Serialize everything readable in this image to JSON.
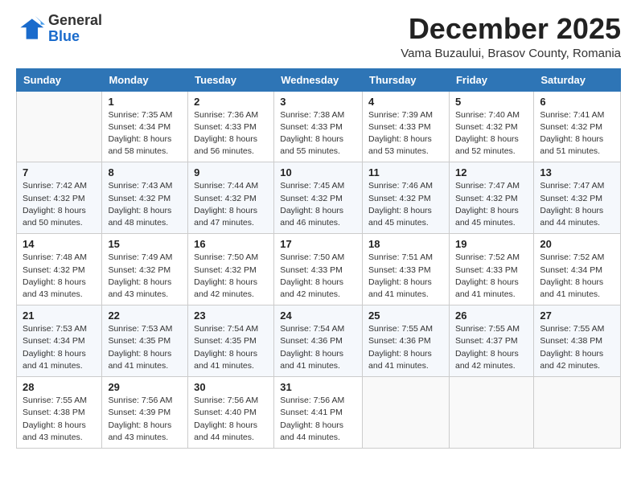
{
  "header": {
    "logo_general": "General",
    "logo_blue": "Blue",
    "month_title": "December 2025",
    "location": "Vama Buzaului, Brasov County, Romania"
  },
  "days_of_week": [
    "Sunday",
    "Monday",
    "Tuesday",
    "Wednesday",
    "Thursday",
    "Friday",
    "Saturday"
  ],
  "weeks": [
    [
      {
        "day": "",
        "info": ""
      },
      {
        "day": "1",
        "info": "Sunrise: 7:35 AM\nSunset: 4:34 PM\nDaylight: 8 hours\nand 58 minutes."
      },
      {
        "day": "2",
        "info": "Sunrise: 7:36 AM\nSunset: 4:33 PM\nDaylight: 8 hours\nand 56 minutes."
      },
      {
        "day": "3",
        "info": "Sunrise: 7:38 AM\nSunset: 4:33 PM\nDaylight: 8 hours\nand 55 minutes."
      },
      {
        "day": "4",
        "info": "Sunrise: 7:39 AM\nSunset: 4:33 PM\nDaylight: 8 hours\nand 53 minutes."
      },
      {
        "day": "5",
        "info": "Sunrise: 7:40 AM\nSunset: 4:32 PM\nDaylight: 8 hours\nand 52 minutes."
      },
      {
        "day": "6",
        "info": "Sunrise: 7:41 AM\nSunset: 4:32 PM\nDaylight: 8 hours\nand 51 minutes."
      }
    ],
    [
      {
        "day": "7",
        "info": "Sunrise: 7:42 AM\nSunset: 4:32 PM\nDaylight: 8 hours\nand 50 minutes."
      },
      {
        "day": "8",
        "info": "Sunrise: 7:43 AM\nSunset: 4:32 PM\nDaylight: 8 hours\nand 48 minutes."
      },
      {
        "day": "9",
        "info": "Sunrise: 7:44 AM\nSunset: 4:32 PM\nDaylight: 8 hours\nand 47 minutes."
      },
      {
        "day": "10",
        "info": "Sunrise: 7:45 AM\nSunset: 4:32 PM\nDaylight: 8 hours\nand 46 minutes."
      },
      {
        "day": "11",
        "info": "Sunrise: 7:46 AM\nSunset: 4:32 PM\nDaylight: 8 hours\nand 45 minutes."
      },
      {
        "day": "12",
        "info": "Sunrise: 7:47 AM\nSunset: 4:32 PM\nDaylight: 8 hours\nand 45 minutes."
      },
      {
        "day": "13",
        "info": "Sunrise: 7:47 AM\nSunset: 4:32 PM\nDaylight: 8 hours\nand 44 minutes."
      }
    ],
    [
      {
        "day": "14",
        "info": "Sunrise: 7:48 AM\nSunset: 4:32 PM\nDaylight: 8 hours\nand 43 minutes."
      },
      {
        "day": "15",
        "info": "Sunrise: 7:49 AM\nSunset: 4:32 PM\nDaylight: 8 hours\nand 43 minutes."
      },
      {
        "day": "16",
        "info": "Sunrise: 7:50 AM\nSunset: 4:32 PM\nDaylight: 8 hours\nand 42 minutes."
      },
      {
        "day": "17",
        "info": "Sunrise: 7:50 AM\nSunset: 4:33 PM\nDaylight: 8 hours\nand 42 minutes."
      },
      {
        "day": "18",
        "info": "Sunrise: 7:51 AM\nSunset: 4:33 PM\nDaylight: 8 hours\nand 41 minutes."
      },
      {
        "day": "19",
        "info": "Sunrise: 7:52 AM\nSunset: 4:33 PM\nDaylight: 8 hours\nand 41 minutes."
      },
      {
        "day": "20",
        "info": "Sunrise: 7:52 AM\nSunset: 4:34 PM\nDaylight: 8 hours\nand 41 minutes."
      }
    ],
    [
      {
        "day": "21",
        "info": "Sunrise: 7:53 AM\nSunset: 4:34 PM\nDaylight: 8 hours\nand 41 minutes."
      },
      {
        "day": "22",
        "info": "Sunrise: 7:53 AM\nSunset: 4:35 PM\nDaylight: 8 hours\nand 41 minutes."
      },
      {
        "day": "23",
        "info": "Sunrise: 7:54 AM\nSunset: 4:35 PM\nDaylight: 8 hours\nand 41 minutes."
      },
      {
        "day": "24",
        "info": "Sunrise: 7:54 AM\nSunset: 4:36 PM\nDaylight: 8 hours\nand 41 minutes."
      },
      {
        "day": "25",
        "info": "Sunrise: 7:55 AM\nSunset: 4:36 PM\nDaylight: 8 hours\nand 41 minutes."
      },
      {
        "day": "26",
        "info": "Sunrise: 7:55 AM\nSunset: 4:37 PM\nDaylight: 8 hours\nand 42 minutes."
      },
      {
        "day": "27",
        "info": "Sunrise: 7:55 AM\nSunset: 4:38 PM\nDaylight: 8 hours\nand 42 minutes."
      }
    ],
    [
      {
        "day": "28",
        "info": "Sunrise: 7:55 AM\nSunset: 4:38 PM\nDaylight: 8 hours\nand 43 minutes."
      },
      {
        "day": "29",
        "info": "Sunrise: 7:56 AM\nSunset: 4:39 PM\nDaylight: 8 hours\nand 43 minutes."
      },
      {
        "day": "30",
        "info": "Sunrise: 7:56 AM\nSunset: 4:40 PM\nDaylight: 8 hours\nand 44 minutes."
      },
      {
        "day": "31",
        "info": "Sunrise: 7:56 AM\nSunset: 4:41 PM\nDaylight: 8 hours\nand 44 minutes."
      },
      {
        "day": "",
        "info": ""
      },
      {
        "day": "",
        "info": ""
      },
      {
        "day": "",
        "info": ""
      }
    ]
  ]
}
